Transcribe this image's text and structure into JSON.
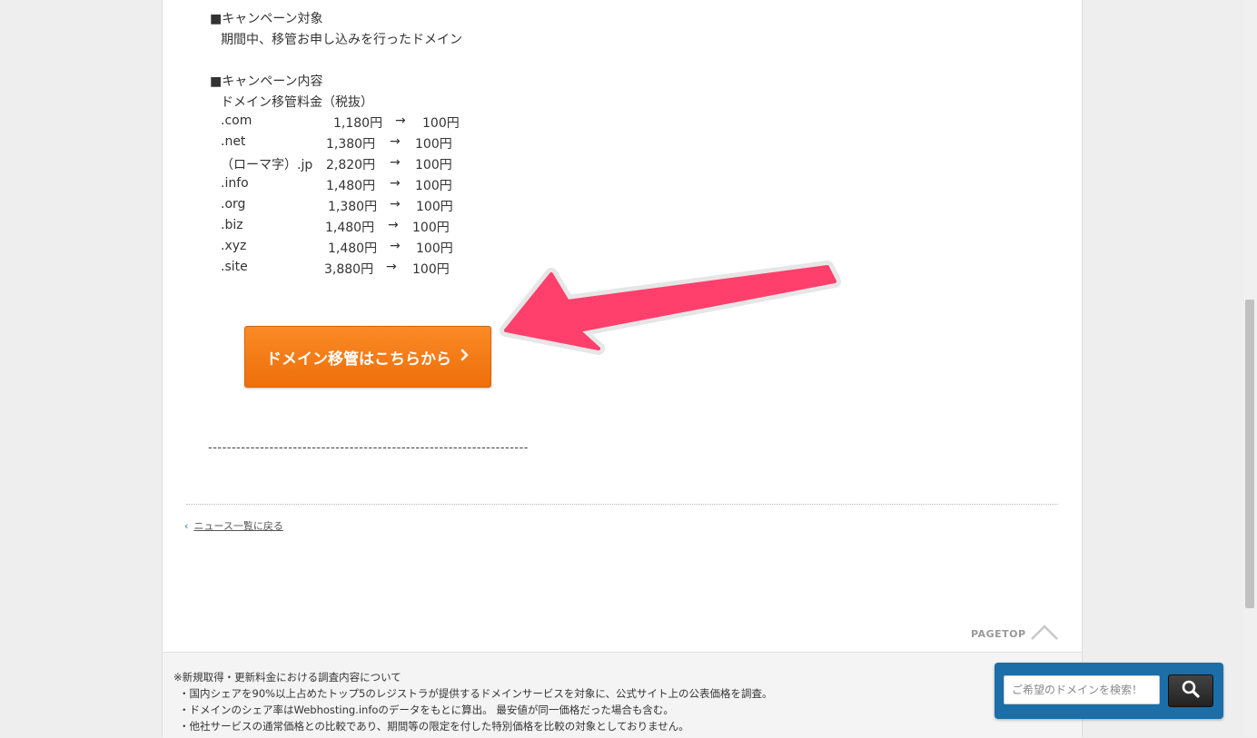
{
  "campaign": {
    "target_heading": "■キャンペーン対象",
    "target_text": "期間中、移管お申し込みを行ったドメイン",
    "content_heading": "■キャンペーン内容",
    "price_caption": "ドメイン移管料金（税抜）",
    "arrow_symbol": "→",
    "prices": [
      {
        "tld": ".com",
        "old": "1,180円",
        "new": "100円"
      },
      {
        "tld": ".net",
        "old": "1,380円",
        "new": "100円"
      },
      {
        "tld": "（ローマ字）.jp",
        "old": "2,820円",
        "new": "100円"
      },
      {
        "tld": ".info",
        "old": "1,480円",
        "new": "100円"
      },
      {
        "tld": ".org",
        "old": "1,380円",
        "new": "100円"
      },
      {
        "tld": ".biz",
        "old": "1,480円",
        "new": "100円"
      },
      {
        "tld": ".xyz",
        "old": "1,480円",
        "new": "100円"
      },
      {
        "tld": ".site",
        "old": "3,880円",
        "new": "100円"
      }
    ],
    "cta_label": "ドメイン移管はこちらから",
    "divider": "--------------------------------------------------------------------"
  },
  "nav": {
    "back_label": "ニュース一覧に戻る",
    "pagetop_label": "PAGETOP"
  },
  "footer": {
    "notes": [
      "※新規取得・更新料金における調査内容について",
      "・国内シェアを90%以上占めたトップ5のレジストラが提供するドメインサービスを対象に、公式サイト上の公表価格を調査。",
      "・ドメインのシェア率はWebhosting.infoのデータをもとに算出。 最安値が同一価格だった場合も含む。",
      "・他社サービスの通常価格との比較であり、期間等の限定を付した特別価格を比較の対象としておりません。"
    ]
  },
  "search": {
    "placeholder": "ご希望のドメインを検索！"
  },
  "colors": {
    "cta": "#f57f17",
    "annotation_arrow": "#ff3f6c",
    "search_widget": "#1b6ea8"
  }
}
